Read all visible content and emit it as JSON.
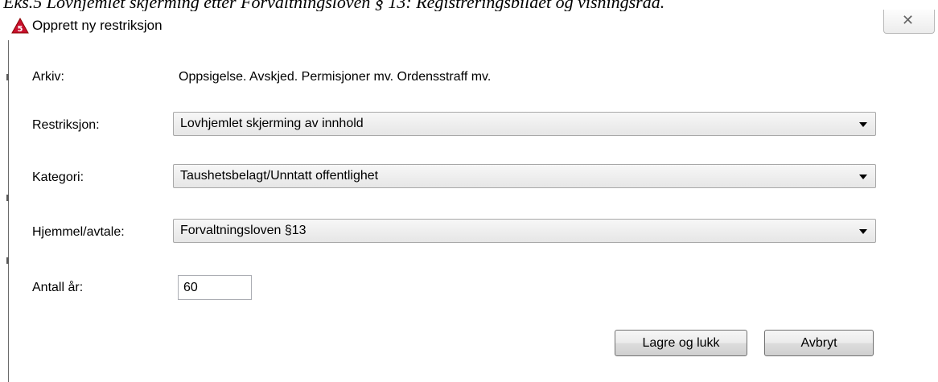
{
  "caption": "Eks.5 Lovhjemlet skjerming etter Forvaltningsloven § 13: Registreringsbildet og visningsråd.",
  "window": {
    "title": "Opprett ny restriksjon",
    "app_icon": "acos-warning-triangle-icon",
    "close_icon": "close-icon",
    "close_glyph": "✕"
  },
  "form": {
    "arkiv": {
      "label": "Arkiv:",
      "value": "Oppsigelse. Avskjed. Permisjoner mv. Ordensstraff mv."
    },
    "restriksjon": {
      "label": "Restriksjon:",
      "selected": "Lovhjemlet skjerming av innhold"
    },
    "kategori": {
      "label": "Kategori:",
      "selected": "Taushetsbelagt/Unntatt offentlighet"
    },
    "hjemmel": {
      "label": "Hjemmel/avtale:",
      "selected": "Forvaltningsloven §13"
    },
    "antall_ar": {
      "label": "Antall år:",
      "value": "60"
    }
  },
  "buttons": {
    "save_close": "Lagre og lukk",
    "cancel": "Avbryt"
  },
  "colors": {
    "icon_red": "#c8102e",
    "icon_border": "#8b0000"
  }
}
